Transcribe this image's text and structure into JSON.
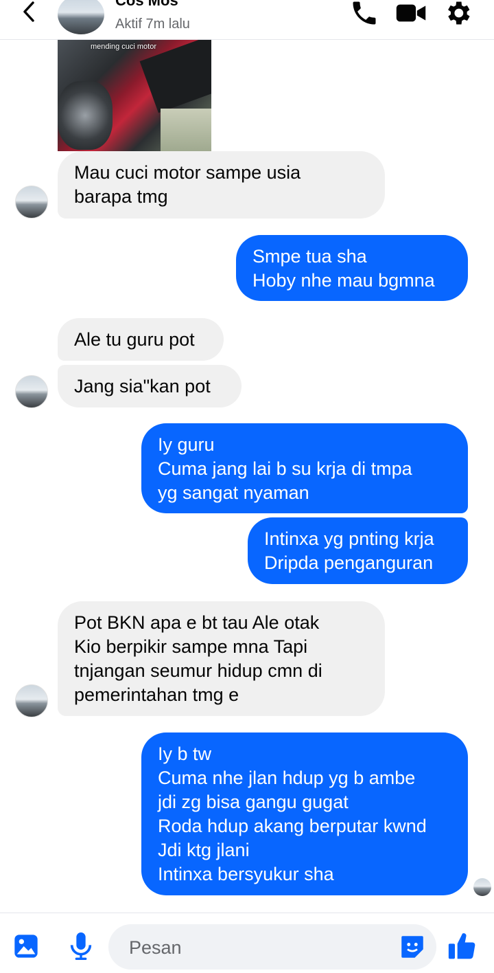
{
  "header": {
    "contact_name": "Cos Mos",
    "status": "Aktif 7m lalu",
    "icons": [
      "back-chevron-icon",
      "phone-icon",
      "video-camera-icon",
      "gear-icon"
    ]
  },
  "shared_image": {
    "caption": "mending cuci motor"
  },
  "messages": [
    {
      "from": "them",
      "text": "Mau cuci motor sampe usia\nbarapa tmg"
    },
    {
      "from": "me",
      "text": "Smpe tua sha\nHoby nhe mau bgmna"
    },
    {
      "from": "them",
      "text": "Ale tu guru pot"
    },
    {
      "from": "them",
      "text": "Jang sia\"kan pot"
    },
    {
      "from": "me",
      "text": "Iy guru\nCuma jang lai b su krja di tmpa\nyg sangat nyaman"
    },
    {
      "from": "me",
      "text": "Intinxa yg pnting krja\nDripda penganguran"
    },
    {
      "from": "them",
      "text": "Pot BKN apa e bt tau Ale otak\nKio berpikir sampe mna Tapi\ntnjangan seumur hidup cmn di\npemerintahan tmg e"
    },
    {
      "from": "me",
      "text": "Iy b tw\nCuma nhe jlan hdup yg b ambe\njdi zg bisa gangu gugat\nRoda hdup akang berputar kwnd\nJdi ktg jlani\nIntinxa bersyukur sha"
    }
  ],
  "composer": {
    "placeholder": "Pesan",
    "icons": [
      "image-icon",
      "microphone-icon",
      "sticker-icon",
      "thumbs-up-icon"
    ]
  },
  "colors": {
    "accent": "#0866ff",
    "incoming_bubble": "#f0f0f0",
    "header_icon": "#050505"
  }
}
